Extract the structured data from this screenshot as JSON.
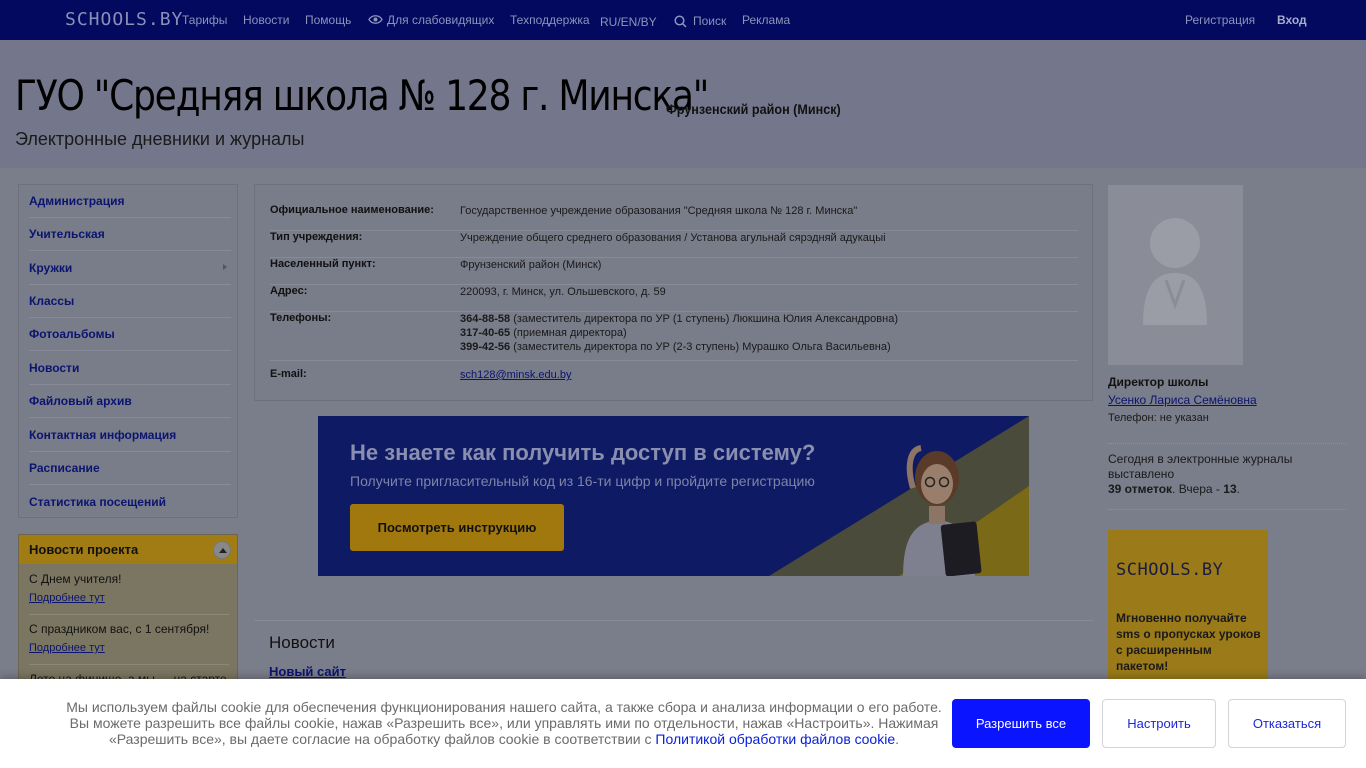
{
  "topnav": {
    "logo": "SCHOOLS.BY",
    "tariffs": "Тарифы",
    "news": "Новости",
    "help": "Помощь",
    "low_vision": "Для слабовидящих",
    "support": "Техподдержка",
    "languages": "RU/EN/BY",
    "search": "Поиск",
    "ads": "Реклама",
    "register": "Регистрация",
    "login": "Вход"
  },
  "header": {
    "title": "ГУО \"Средняя школа № 128 г. Минска\"",
    "district": "Фрунзенский район (Минск)",
    "subtitle": "Электронные дневники и журналы"
  },
  "sidebar": {
    "items": [
      {
        "label": "Администрация"
      },
      {
        "label": "Учительская"
      },
      {
        "label": "Кружки"
      },
      {
        "label": "Классы"
      },
      {
        "label": "Фотоальбомы"
      },
      {
        "label": "Новости"
      },
      {
        "label": "Файловый архив"
      },
      {
        "label": "Контактная информация"
      },
      {
        "label": "Расписание"
      },
      {
        "label": "Статистика посещений"
      }
    ]
  },
  "project_news": {
    "title": "Новости проекта",
    "entries": [
      {
        "text": "С Днем учителя!",
        "more": "Подробнее тут"
      },
      {
        "text": "С праздником вас, с 1 сентября!",
        "more": "Подробнее тут"
      },
      {
        "text": "Лето на финише, а мы — на старте"
      }
    ]
  },
  "info": {
    "official_name_label": "Официальное наименование:",
    "official_name": "Государственное учреждение образования \"Средняя школа № 128 г. Минска\"",
    "type_label": "Тип учреждения:",
    "type": "Учреждение общего среднего образования / Установа агульнай сярэдняй адукацыі",
    "locality_label": "Населенный пункт:",
    "locality": "Фрунзенский район (Минск)",
    "address_label": "Адрес:",
    "address": "220093, г. Минск, ул. Ольшевского, д. 59",
    "phones_label": "Телефоны:",
    "phones": [
      {
        "number": "364-88-58",
        "desc": " (заместитель директора по УР (1 ступень) Люкшина Юлия Александровна)"
      },
      {
        "number": "317-40-65",
        "desc": " (приемная директора)"
      },
      {
        "number": "399-42-56",
        "desc": " (заместитель директора по УР (2-3 ступень) Мурашко Ольга Васильевна)"
      }
    ],
    "email_label": "E-mail:",
    "email": "sch128@minsk.edu.by"
  },
  "banner": {
    "heading": "Не знаете как получить доступ в систему?",
    "text": "Получите пригласительный код из 16-ти цифр и пройдите регистрацию",
    "button": "Посмотреть инструкцию"
  },
  "news_section": {
    "title": "Новости",
    "first_item": "Новый сайт"
  },
  "director": {
    "title": "Директор школы",
    "name": "Усенко Лариса Семёновна",
    "phone": "Телефон: не указан"
  },
  "stats": {
    "line": "Сегодня в электронные журналы выставлено",
    "count": "39 отметок",
    "yesterday_label": ". Вчера - ",
    "yesterday": "13",
    "end": "."
  },
  "ad": {
    "logo": "SCHOOLS.BY",
    "text": "Мгновенно получайте sms о пропусках уроков с расширенным пакетом!"
  },
  "cookie": {
    "text": "Мы используем файлы cookie для обеспечения функционирования нашего сайта, а также сбора и анализа информации о его работе. Вы можете разрешить все файлы cookie, нажав «Разрешить все», или управлять ими по отдельности, нажав «Настроить». Нажимая «Разрешить все», вы даете согласие на обработку файлов cookie в соответствии с ",
    "policy_link": "Политикой обработки файлов cookie",
    "end": ".",
    "allow_all": "Разрешить все",
    "configure": "Настроить",
    "decline": "Отказаться"
  }
}
